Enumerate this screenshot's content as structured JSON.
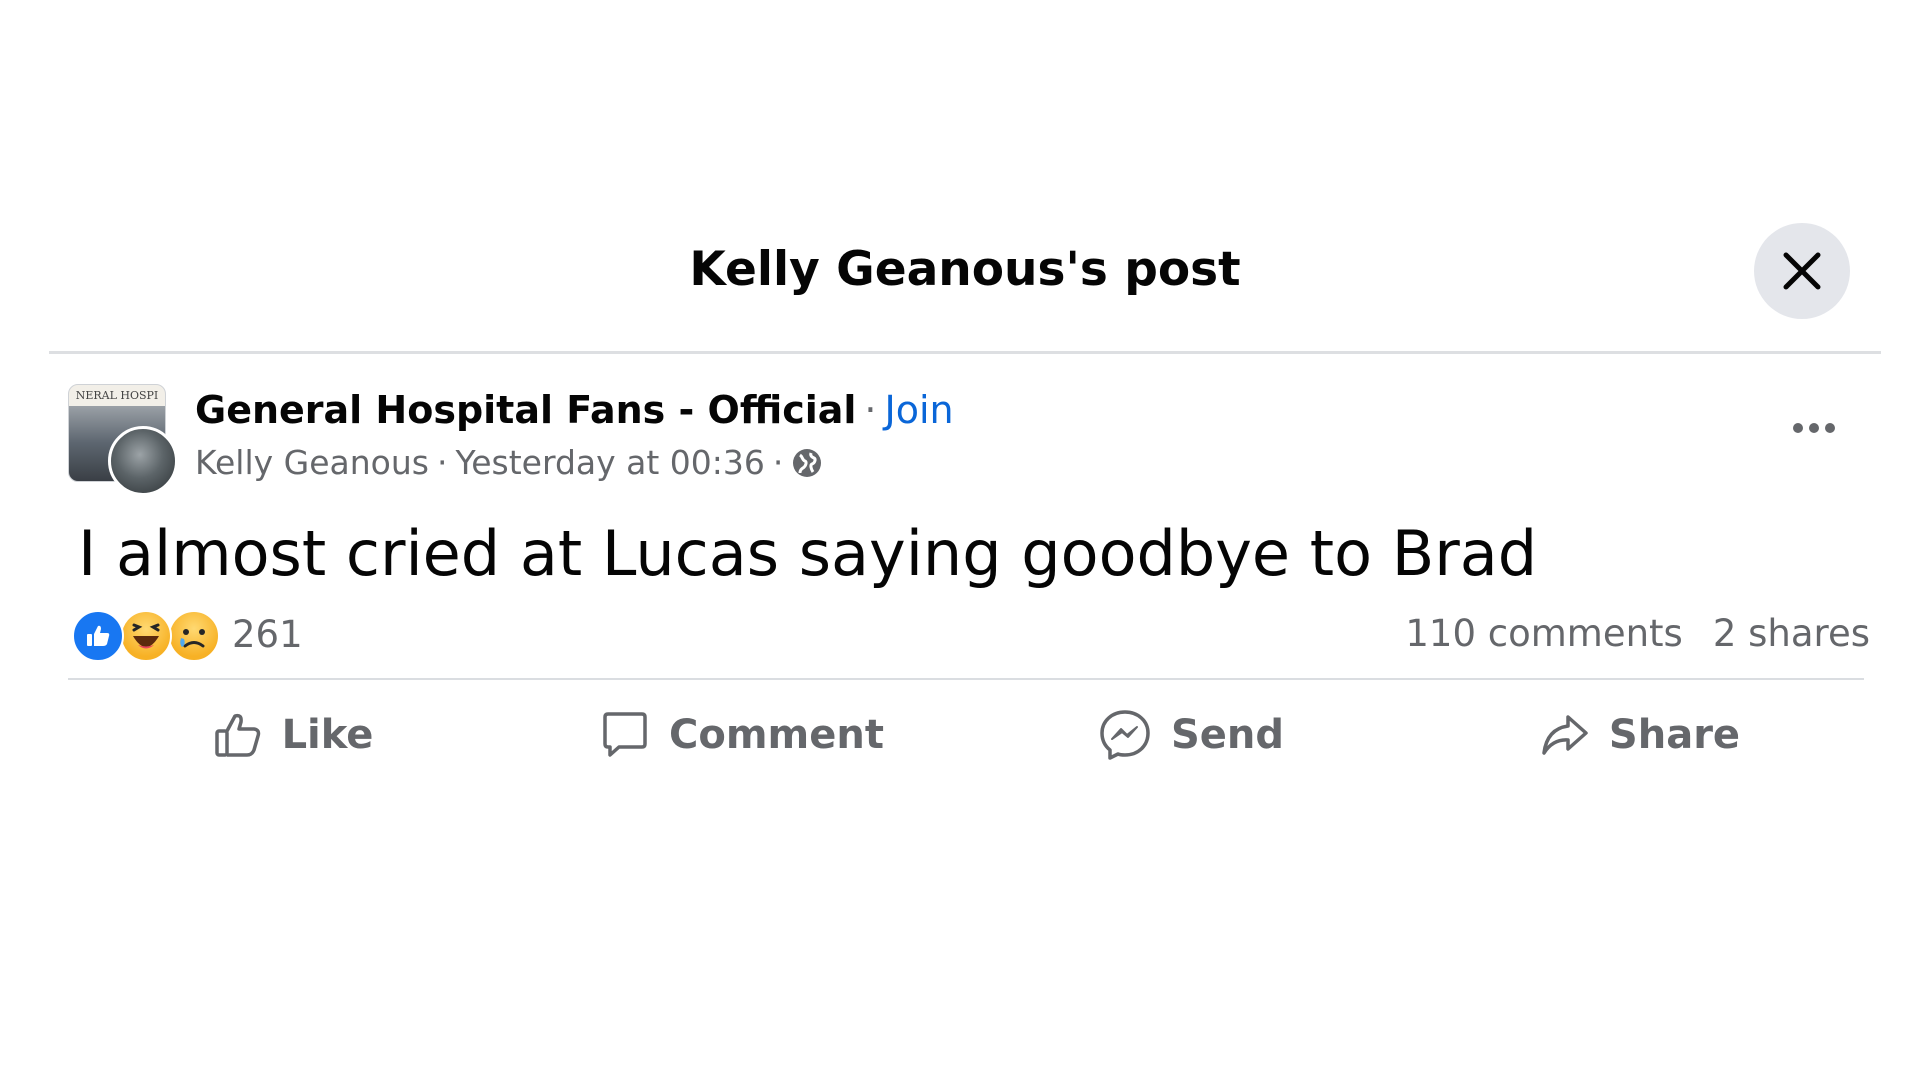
{
  "header": {
    "title": "Kelly Geanous's post",
    "close_icon": "close-icon"
  },
  "post": {
    "group_name": "General Hospital Fans - Official",
    "group_avatar_banner": "NERAL HOSPI",
    "separator": "·",
    "join_label": "Join",
    "author": "Kelly Geanous",
    "timestamp": "Yesterday at 00:36",
    "audience_icon": "globe-icon",
    "more_icon": "more-options-icon",
    "text": "I almost cried at Lucas saying goodbye to Brad"
  },
  "engagement": {
    "reaction_icons": [
      "like-reaction-icon",
      "haha-reaction-icon",
      "sad-reaction-icon"
    ],
    "reaction_count": "261",
    "comments": "110 comments",
    "shares": "2 shares"
  },
  "actions": {
    "like": "Like",
    "comment": "Comment",
    "send": "Send",
    "share": "Share"
  },
  "colors": {
    "link": "#0a66d8",
    "secondary_text": "#65676b",
    "like_blue": "#1877f2",
    "close_bg": "#e4e6eb"
  }
}
